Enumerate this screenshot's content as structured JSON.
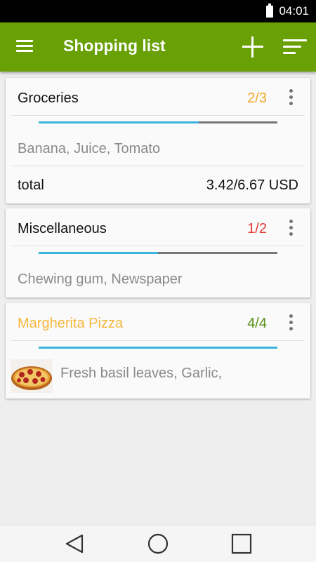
{
  "status": {
    "time": "04:01"
  },
  "app_bar": {
    "title": "Shopping list",
    "menu_icon": "hamburger-menu-icon",
    "add_icon": "plus-icon",
    "sort_icon": "sort-icon",
    "color": "#68a005"
  },
  "lists": [
    {
      "name": "Groceries",
      "count": "2/3",
      "count_color": "#f0a526",
      "progress": 0.67,
      "items": "Banana, Juice, Tomato",
      "total_label": "total",
      "total_value": "3.42/6.67 USD"
    },
    {
      "name": "Miscellaneous",
      "count": "1/2",
      "count_color": "#e53935",
      "progress": 0.5,
      "items": "Chewing gum, Newspaper"
    },
    {
      "name": "Margherita Pizza",
      "name_color": "#f6b73c",
      "count": "4/4",
      "count_color": "#5a8f1a",
      "progress": 1.0,
      "items": "Fresh basil leaves, Garlic,",
      "thumbnail": "pizza-photo"
    }
  ],
  "colors": {
    "progress": "#3ab4dc",
    "track": "#777777"
  },
  "nav": {
    "back_icon": "back-triangle-icon",
    "home_icon": "home-circle-icon",
    "recents_icon": "recents-square-icon"
  }
}
